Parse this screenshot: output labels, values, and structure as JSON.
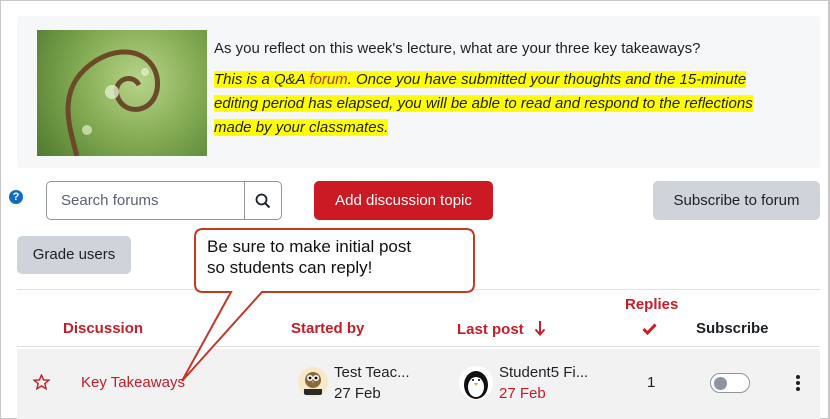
{
  "intro": {
    "question": "As you reflect on this week's lecture, what are your three key takeaways?",
    "note_before": "This is a Q&A ",
    "note_link": "forum",
    "note_after": ". Once you have submitted your thoughts and the 15-minute editing period has elapsed, you will be able to read and respond to the reflections made by your classmates."
  },
  "toolbar": {
    "help_glyph": "?",
    "search_placeholder": "Search forums",
    "add_topic": "Add discussion topic",
    "subscribe_forum": "Subscribe to forum",
    "grade_users": "Grade users"
  },
  "callout": {
    "line1": "Be sure to make initial post",
    "line2": "so students can reply!"
  },
  "table": {
    "headers": {
      "discussion": "Discussion",
      "started_by": "Started by",
      "last_post": "Last post",
      "replies": "Replies",
      "subscribe": "Subscribe"
    },
    "rows": [
      {
        "title": "Key Takeaways",
        "started_by_name": "Test Teac...",
        "started_by_date": "27 Feb",
        "last_post_name": "Student5 Fi...",
        "last_post_date": "27 Feb",
        "replies": "1",
        "subscribed": false
      }
    ]
  },
  "colors": {
    "accent": "#c41e28",
    "primary_button": "#cc1a25",
    "secondary_button": "#ced4da",
    "highlight": "#ffff00",
    "callout_border": "#c0392b"
  },
  "icons": {
    "help": "help-icon",
    "search": "search-icon",
    "sort": "sort-down-arrow-icon",
    "replies_check": "check-icon",
    "star": "star-outline-icon",
    "more": "kebab-menu-icon"
  }
}
